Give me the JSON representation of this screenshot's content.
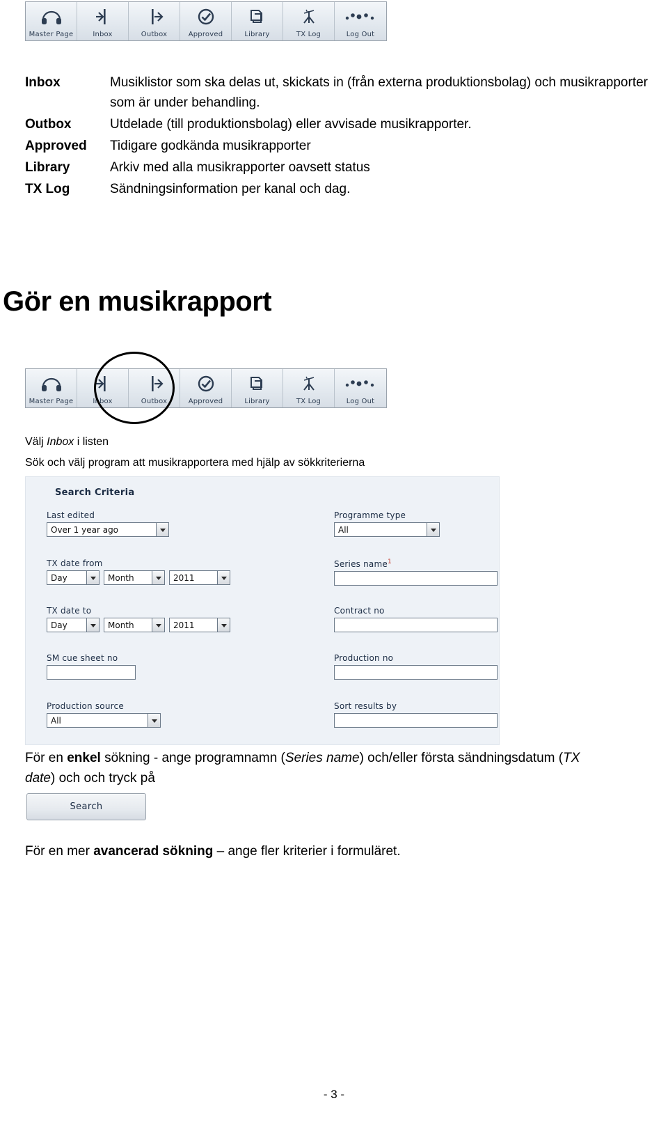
{
  "toolbar": {
    "items": [
      {
        "label": "Master Page",
        "icon": "headphones-icon"
      },
      {
        "label": "Inbox",
        "icon": "inbox-arrow-icon"
      },
      {
        "label": "Outbox",
        "icon": "outbox-arrow-icon"
      },
      {
        "label": "Approved",
        "icon": "check-circle-icon"
      },
      {
        "label": "Library",
        "icon": "copy-pages-icon"
      },
      {
        "label": "TX Log",
        "icon": "transmitter-icon"
      },
      {
        "label": "Log Out",
        "icon": "dots-icon"
      }
    ]
  },
  "definitions": [
    {
      "term": "Inbox",
      "desc": "Musiklistor som ska delas ut, skickats in (från externa produktionsbolag) och musikrapporter som är under behandling."
    },
    {
      "term": "Outbox",
      "desc": "Utdelade (till produktionsbolag) eller avvisade musikrapporter."
    },
    {
      "term": "Approved",
      "desc": "Tidigare godkända musikrapporter"
    },
    {
      "term": "Library",
      "desc": "Arkiv med alla musikrapporter oavsett status"
    },
    {
      "term": "TX Log",
      "desc": "Sändningsinformation per kanal och dag."
    }
  ],
  "heading": "Gör en musikrapport",
  "instructions": {
    "line1_prefix": "Välj ",
    "line1_italic": "Inbox",
    "line1_suffix": " i listen",
    "line2": "Sök och välj program att musikrapportera med hjälp av sökkriterierna"
  },
  "search_form": {
    "title": "Search Criteria",
    "fields": {
      "last_edited": {
        "label": "Last edited",
        "value": "Over 1 year ago",
        "type": "select"
      },
      "tx_date_from": {
        "label": "TX date from",
        "day": "Day",
        "month": "Month",
        "year": "2011"
      },
      "tx_date_to": {
        "label": "TX date to",
        "day": "Day",
        "month": "Month",
        "year": "2011"
      },
      "sm_cue_sheet_no": {
        "label": "SM cue sheet no",
        "value": ""
      },
      "production_source": {
        "label": "Production source",
        "value": "All",
        "type": "select"
      },
      "programme_type": {
        "label": "Programme type",
        "value": "All",
        "type": "select"
      },
      "series_name": {
        "label": "Series name",
        "required_marker": "1",
        "value": ""
      },
      "contract_no": {
        "label": "Contract no",
        "value": ""
      },
      "production_no": {
        "label": "Production no",
        "value": ""
      },
      "sort_results_by": {
        "label": "Sort results by",
        "value": ""
      }
    }
  },
  "paragraph_after": {
    "part1": "För en ",
    "bold1": "enkel",
    "part2": " sökning - ange programnamn (",
    "italic1": "Series name",
    "part3": ") och/eller första sändningsdatum (",
    "italic2": "TX date",
    "part4": ") och och tryck på"
  },
  "search_button": {
    "label": "Search"
  },
  "paragraph_last": {
    "part1": "För en mer ",
    "bold1": "avancerad sökning",
    "part2": " – ange fler kriterier i formuläret."
  },
  "page_number": "- 3 -"
}
